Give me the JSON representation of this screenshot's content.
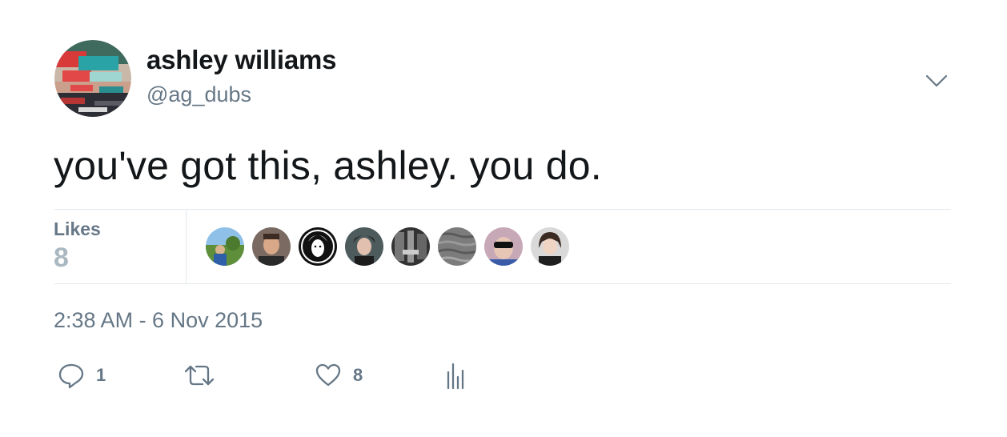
{
  "author": {
    "display_name": "ashley williams",
    "screen_name": "@ag_dubs",
    "avatar_icon": "avatar-glitch-portrait"
  },
  "tweet": {
    "text": "you've got this, ashley. you do."
  },
  "stats": {
    "likes_label": "Likes",
    "likes_value": "8",
    "likers": [
      {
        "icon": "avatar-outdoor"
      },
      {
        "icon": "avatar-man-portrait"
      },
      {
        "icon": "avatar-drawn-portrait"
      },
      {
        "icon": "avatar-woman-portrait"
      },
      {
        "icon": "avatar-abstract-dark"
      },
      {
        "icon": "avatar-texture-grey"
      },
      {
        "icon": "avatar-sunglasses"
      },
      {
        "icon": "avatar-woman-dark-hair"
      }
    ]
  },
  "timestamp": "2:38 AM - 6 Nov 2015",
  "actions": {
    "reply_count": "1",
    "like_count": "8"
  },
  "colors": {
    "text_primary": "#14171a",
    "text_secondary": "#657786",
    "icon": "#657786",
    "divider": "#e1e8ed",
    "stat_value": "#aab8c2"
  }
}
